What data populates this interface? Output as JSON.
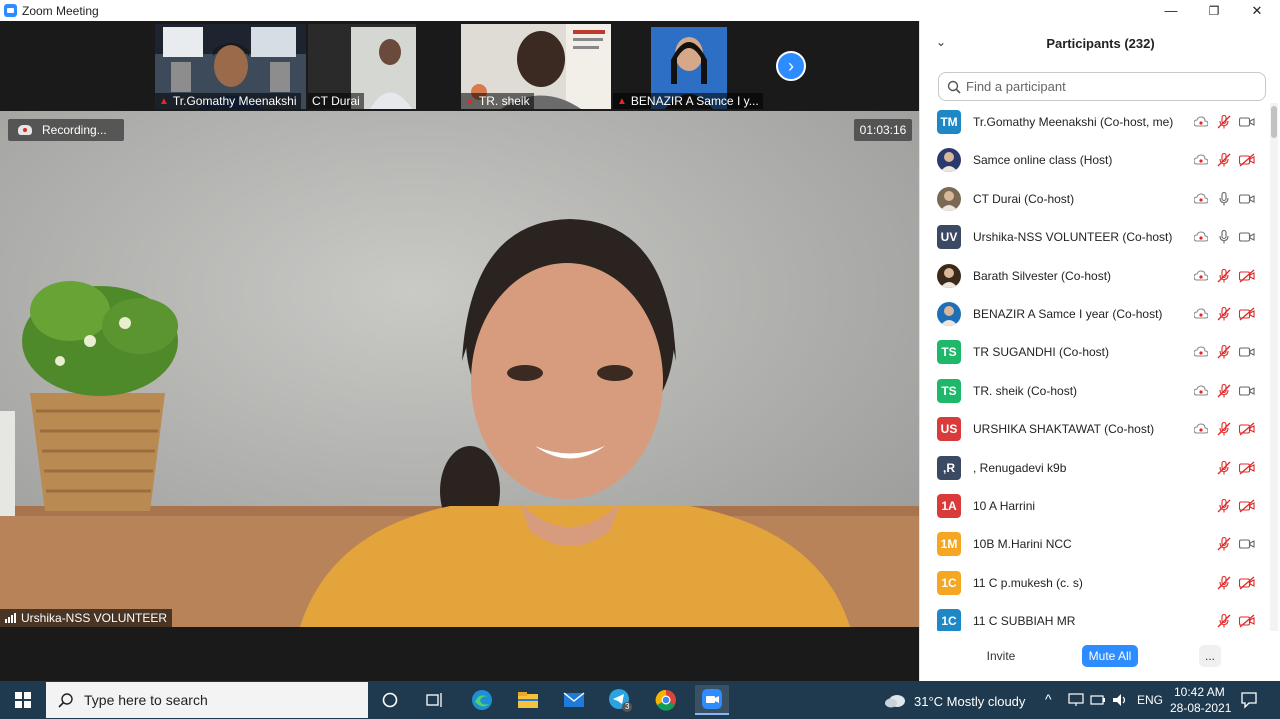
{
  "window": {
    "title": "Zoom Meeting",
    "controls": [
      "—",
      "❐",
      "✕"
    ]
  },
  "thumbnails": [
    {
      "name": "Tr.Gomathy Meenakshi",
      "muted": true
    },
    {
      "name": "CT Durai",
      "muted": false
    },
    {
      "name": "TR. sheik",
      "muted": true
    },
    {
      "name": "BENAZIR A Samce I y...",
      "muted": true
    }
  ],
  "next_page_glyph": "›",
  "recording": {
    "label": "Recording..."
  },
  "timer": "01:03:16",
  "speaker": {
    "name": "Urshika-NSS VOLUNTEER"
  },
  "participants_panel": {
    "title": "Participants (232)",
    "search_placeholder": "Find a participant",
    "rows": [
      {
        "initials": "TM",
        "avatar_color": "#1e88c7",
        "name": "Tr.Gomathy Meenakshi (Co-host, me)",
        "rec": true,
        "audio": "muted",
        "video": "on"
      },
      {
        "initials": "",
        "avatar_color": "#2a3a6e",
        "name": "Samce online class (Host)",
        "rec": true,
        "audio": "muted",
        "video": "off"
      },
      {
        "initials": "",
        "avatar_color": "#7a6a55",
        "name": "CT Durai (Co-host)",
        "rec": true,
        "audio": "on",
        "video": "on"
      },
      {
        "initials": "UV",
        "avatar_color": "#3b4a63",
        "name": "Urshika-NSS VOLUNTEER (Co-host)",
        "rec": true,
        "audio": "on",
        "video": "on"
      },
      {
        "initials": "",
        "avatar_color": "#3b2a1a",
        "name": "Barath Silvester (Co-host)",
        "rec": true,
        "audio": "muted",
        "video": "off"
      },
      {
        "initials": "",
        "avatar_color": "#1f6fb8",
        "name": "BENAZIR A Samce I year (Co-host)",
        "rec": true,
        "audio": "muted",
        "video": "off"
      },
      {
        "initials": "TS",
        "avatar_color": "#1fb86a",
        "name": "TR SUGANDHI (Co-host)",
        "rec": true,
        "audio": "muted",
        "video": "on"
      },
      {
        "initials": "TS",
        "avatar_color": "#1fb86a",
        "name": "TR. sheik (Co-host)",
        "rec": true,
        "audio": "muted",
        "video": "on"
      },
      {
        "initials": "US",
        "avatar_color": "#d93b3b",
        "name": "URSHIKA SHAKTAWAT (Co-host)",
        "rec": true,
        "audio": "muted",
        "video": "off"
      },
      {
        "initials": ",R",
        "avatar_color": "#3b4a63",
        "name": ", Renugadevi k9b",
        "rec": false,
        "audio": "muted",
        "video": "off"
      },
      {
        "initials": "1A",
        "avatar_color": "#d93b3b",
        "name": "10 A Harrini",
        "rec": false,
        "audio": "muted",
        "video": "off"
      },
      {
        "initials": "1M",
        "avatar_color": "#f5a623",
        "name": "10B M.Harini NCC",
        "rec": false,
        "audio": "muted",
        "video": "on"
      },
      {
        "initials": "1C",
        "avatar_color": "#f5a623",
        "name": "11 C p.mukesh (c. s)",
        "rec": false,
        "audio": "muted",
        "video": "off"
      },
      {
        "initials": "1C",
        "avatar_color": "#1e88c7",
        "name": "11 C SUBBIAH MR",
        "rec": false,
        "audio": "muted",
        "video": "off"
      }
    ],
    "footer": {
      "invite": "Invite",
      "mute_all": "Mute All",
      "more": "..."
    }
  },
  "taskbar": {
    "search_placeholder": "Type here to search",
    "weather": "31°C  Mostly cloudy",
    "language": "ENG",
    "time": "10:42 AM",
    "date": "28-08-2021",
    "telegram_badge": "3"
  },
  "colors": {
    "zoom_blue": "#2d8cff",
    "mute_red": "#e02828",
    "taskbar": "#1f3a4e"
  }
}
